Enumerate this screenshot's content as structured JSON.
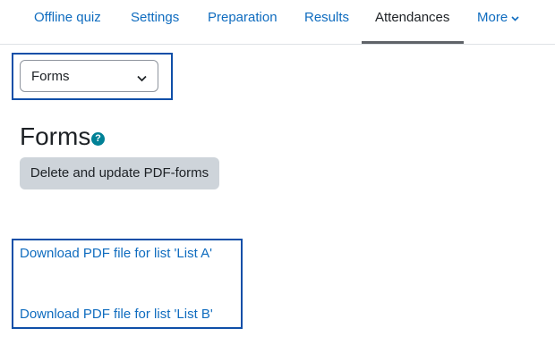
{
  "tabs": [
    {
      "label": "Offline quiz"
    },
    {
      "label": "Settings"
    },
    {
      "label": "Preparation"
    },
    {
      "label": "Results"
    },
    {
      "label": "Attendances",
      "active": true
    },
    {
      "label": "More"
    }
  ],
  "select": {
    "value": "Forms"
  },
  "page": {
    "title": "Forms",
    "help_icon": "?"
  },
  "buttons": {
    "delete_update": "Delete and update PDF-forms"
  },
  "downloads": [
    {
      "label": "Download PDF file for list 'List A'"
    },
    {
      "label": "Download PDF file for list 'List B'"
    }
  ],
  "colors": {
    "link": "#0f6cbf",
    "help": "#008196",
    "highlight": "#0f4fa8"
  }
}
